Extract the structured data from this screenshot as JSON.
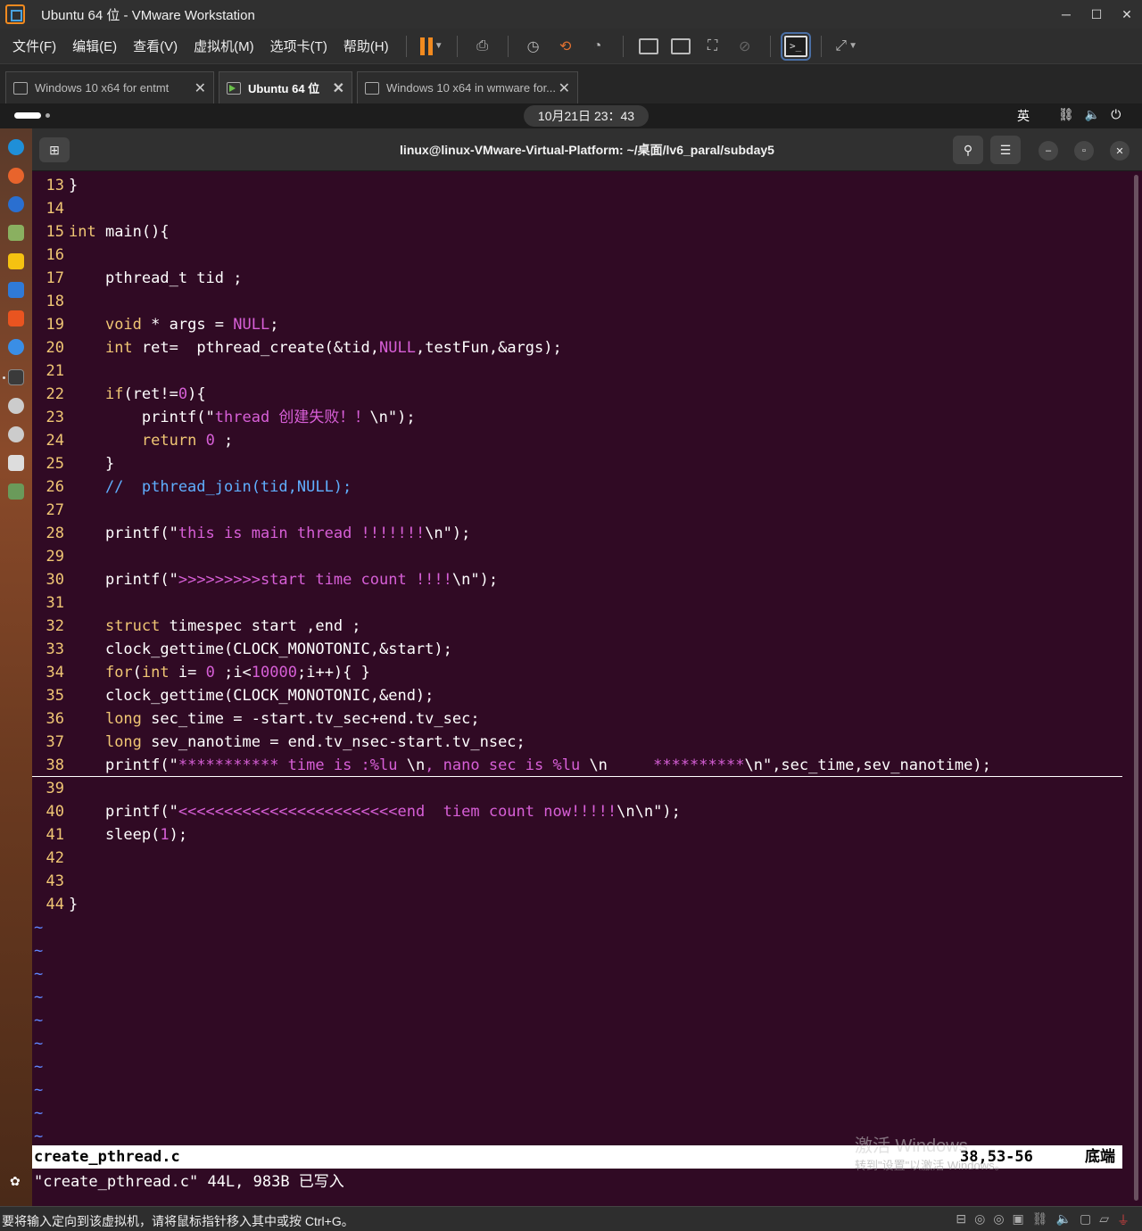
{
  "window": {
    "title": "Ubuntu 64 位 - VMware Workstation"
  },
  "menu": [
    "文件(F)",
    "编辑(E)",
    "查看(V)",
    "虚拟机(M)",
    "选项卡(T)",
    "帮助(H)"
  ],
  "tabs": [
    {
      "label": "Windows 10 x64 for entmt",
      "active": false
    },
    {
      "label": "Ubuntu 64 位",
      "active": true
    },
    {
      "label": "Windows 10 x64 in wmware for...",
      "active": false
    }
  ],
  "ubuntu_bar": {
    "clock": "10月21日  23：43",
    "ime": "英"
  },
  "terminal": {
    "title": "linux@linux-VMware-Virtual-Platform: ~/桌面/lv6_paral/subday5",
    "status_filename": "create_pthread.c",
    "status_position": "38,53-56",
    "status_where": "底端",
    "message": "\"create_pthread.c\" 44L, 983B 已写入"
  },
  "code": [
    {
      "n": "13",
      "t": "}"
    },
    {
      "n": "14",
      "t": ""
    },
    {
      "n": "15",
      "t": "int main(){"
    },
    {
      "n": "16",
      "t": ""
    },
    {
      "n": "17",
      "t": "    pthread_t tid ;"
    },
    {
      "n": "18",
      "t": ""
    },
    {
      "n": "19",
      "t": "    void * args = NULL;"
    },
    {
      "n": "20",
      "t": "    int ret=  pthread_create(&tid,NULL,testFun,&args);"
    },
    {
      "n": "21",
      "t": ""
    },
    {
      "n": "22",
      "t": "    if(ret!=0){"
    },
    {
      "n": "23",
      "t": "        printf(\"thread 创建失败！！\\n\");"
    },
    {
      "n": "24",
      "t": "        return 0 ;"
    },
    {
      "n": "25",
      "t": "    }"
    },
    {
      "n": "26",
      "t": "    //  pthread_join(tid,NULL);"
    },
    {
      "n": "27",
      "t": ""
    },
    {
      "n": "28",
      "t": "    printf(\"this is main thread !!!!!!!\\n\");"
    },
    {
      "n": "29",
      "t": ""
    },
    {
      "n": "30",
      "t": "    printf(\">>>>>>>>>start time count !!!!\\n\");"
    },
    {
      "n": "31",
      "t": ""
    },
    {
      "n": "32",
      "t": "    struct timespec start ,end ;"
    },
    {
      "n": "33",
      "t": "    clock_gettime(CLOCK_MONOTONIC,&start);"
    },
    {
      "n": "34",
      "t": "    for(int i= 0 ;i<10000;i++){ }"
    },
    {
      "n": "35",
      "t": "    clock_gettime(CLOCK_MONOTONIC,&end);"
    },
    {
      "n": "36",
      "t": "    long sec_time = -start.tv_sec+end.tv_sec;"
    },
    {
      "n": "37",
      "t": "    long sev_nanotime = end.tv_nsec-start.tv_nsec;"
    },
    {
      "n": "38",
      "t": "    printf(\"*********** time is :%lu \\n, nano sec is %lu \\n     **********\\n\",sec_time,sev_nanotime);"
    },
    {
      "n": "39",
      "t": ""
    },
    {
      "n": "40",
      "t": "    printf(\"<<<<<<<<<<<<<<<<<<<<<<<<end  tiem count now!!!!!\\n\\n\");"
    },
    {
      "n": "41",
      "t": "    sleep(1);"
    },
    {
      "n": "42",
      "t": ""
    },
    {
      "n": "43",
      "t": ""
    },
    {
      "n": "44",
      "t": "}"
    }
  ],
  "tilde_count": 10,
  "watermark": {
    "line1": "激活 Windows",
    "line2": "转到\"设置\"以激活 Windows。"
  },
  "vm_status": "要将输入定向到该虚拟机，请将鼠标指针移入其中或按 Ctrl+G。",
  "colors": {
    "terminal_bg": "#300a24",
    "line_number": "#f0c674",
    "string": "#d75fd7",
    "operator": "#5fd7ff",
    "tilde": "#5f87ff",
    "accent": "#f28a1f"
  }
}
